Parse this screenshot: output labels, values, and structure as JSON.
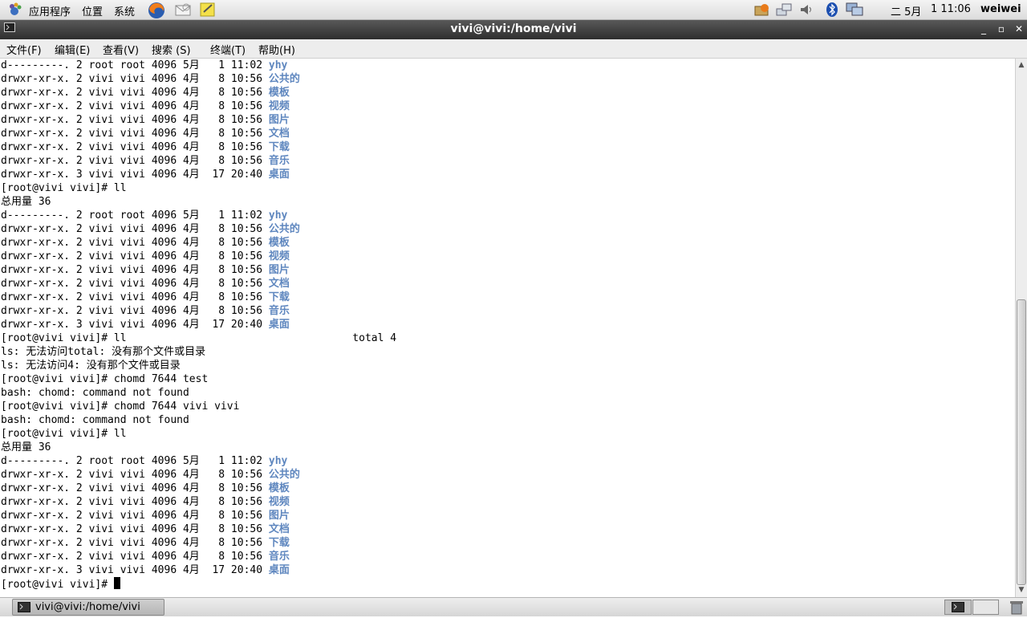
{
  "top_panel": {
    "menus": [
      "应用程序",
      "位置",
      "系统"
    ],
    "date": "二 5月",
    "time": "1 11:06",
    "user": "weiwei"
  },
  "window": {
    "title": "vivi@vivi:/home/vivi",
    "menu": [
      "文件(F)",
      "编辑(E)",
      "查看(V)",
      "搜索 (S)",
      "终端(T)",
      "帮助(H)"
    ]
  },
  "terminal": {
    "lines": [
      {
        "text": "d---------. 2 root root 4096 5月   1 11:02 ",
        "dir": "yhy"
      },
      {
        "text": "drwxr-xr-x. 2 vivi vivi 4096 4月   8 10:56 ",
        "dir": "公共的"
      },
      {
        "text": "drwxr-xr-x. 2 vivi vivi 4096 4月   8 10:56 ",
        "dir": "模板"
      },
      {
        "text": "drwxr-xr-x. 2 vivi vivi 4096 4月   8 10:56 ",
        "dir": "视频"
      },
      {
        "text": "drwxr-xr-x. 2 vivi vivi 4096 4月   8 10:56 ",
        "dir": "图片"
      },
      {
        "text": "drwxr-xr-x. 2 vivi vivi 4096 4月   8 10:56 ",
        "dir": "文档"
      },
      {
        "text": "drwxr-xr-x. 2 vivi vivi 4096 4月   8 10:56 ",
        "dir": "下载"
      },
      {
        "text": "drwxr-xr-x. 2 vivi vivi 4096 4月   8 10:56 ",
        "dir": "音乐"
      },
      {
        "text": "drwxr-xr-x. 3 vivi vivi 4096 4月  17 20:40 ",
        "dir": "桌面"
      },
      {
        "text": "[root@vivi vivi]# ll"
      },
      {
        "text": "总用量 36"
      },
      {
        "text": "d---------. 2 root root 4096 5月   1 11:02 ",
        "dir": "yhy"
      },
      {
        "text": "drwxr-xr-x. 2 vivi vivi 4096 4月   8 10:56 ",
        "dir": "公共的"
      },
      {
        "text": "drwxr-xr-x. 2 vivi vivi 4096 4月   8 10:56 ",
        "dir": "模板"
      },
      {
        "text": "drwxr-xr-x. 2 vivi vivi 4096 4月   8 10:56 ",
        "dir": "视频"
      },
      {
        "text": "drwxr-xr-x. 2 vivi vivi 4096 4月   8 10:56 ",
        "dir": "图片"
      },
      {
        "text": "drwxr-xr-x. 2 vivi vivi 4096 4月   8 10:56 ",
        "dir": "文档"
      },
      {
        "text": "drwxr-xr-x. 2 vivi vivi 4096 4月   8 10:56 ",
        "dir": "下载"
      },
      {
        "text": "drwxr-xr-x. 2 vivi vivi 4096 4月   8 10:56 ",
        "dir": "音乐"
      },
      {
        "text": "drwxr-xr-x. 3 vivi vivi 4096 4月  17 20:40 ",
        "dir": "桌面"
      },
      {
        "text": "[root@vivi vivi]# ll                                    total 4"
      },
      {
        "text": "ls: 无法访问total: 没有那个文件或目录"
      },
      {
        "text": "ls: 无法访问4: 没有那个文件或目录"
      },
      {
        "text": "[root@vivi vivi]# chomd 7644 test"
      },
      {
        "text": "bash: chomd: command not found"
      },
      {
        "text": "[root@vivi vivi]# chomd 7644 vivi vivi"
      },
      {
        "text": "bash: chomd: command not found"
      },
      {
        "text": "[root@vivi vivi]# ll"
      },
      {
        "text": "总用量 36"
      },
      {
        "text": "d---------. 2 root root 4096 5月   1 11:02 ",
        "dir": "yhy"
      },
      {
        "text": "drwxr-xr-x. 2 vivi vivi 4096 4月   8 10:56 ",
        "dir": "公共的"
      },
      {
        "text": "drwxr-xr-x. 2 vivi vivi 4096 4月   8 10:56 ",
        "dir": "模板"
      },
      {
        "text": "drwxr-xr-x. 2 vivi vivi 4096 4月   8 10:56 ",
        "dir": "视频"
      },
      {
        "text": "drwxr-xr-x. 2 vivi vivi 4096 4月   8 10:56 ",
        "dir": "图片"
      },
      {
        "text": "drwxr-xr-x. 2 vivi vivi 4096 4月   8 10:56 ",
        "dir": "文档"
      },
      {
        "text": "drwxr-xr-x. 2 vivi vivi 4096 4月   8 10:56 ",
        "dir": "下载"
      },
      {
        "text": "drwxr-xr-x. 2 vivi vivi 4096 4月   8 10:56 ",
        "dir": "音乐"
      },
      {
        "text": "drwxr-xr-x. 3 vivi vivi 4096 4月  17 20:40 ",
        "dir": "桌面"
      },
      {
        "text": "[root@vivi vivi]# ",
        "cursor": true
      }
    ]
  },
  "taskbar": {
    "task_label": "vivi@vivi:/home/vivi"
  },
  "colors": {
    "directory": "#5f87bf",
    "titlebar": "#3a3a3a"
  }
}
